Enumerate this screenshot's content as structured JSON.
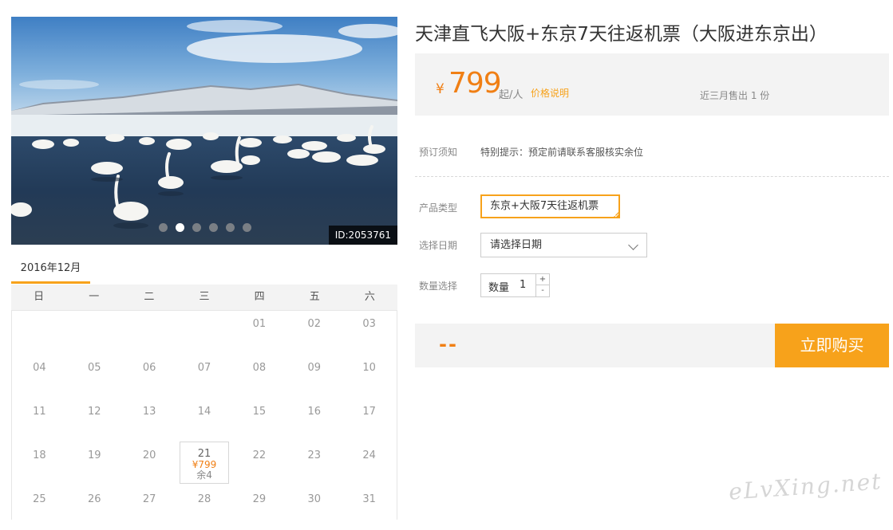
{
  "gallery": {
    "image_alt": "swans on a frozen lake with snowy mountains",
    "slide_count": 6,
    "active_slide": 2,
    "image_id": "ID:2053761"
  },
  "calendar": {
    "month": "2016年12月",
    "weekdays": [
      "日",
      "一",
      "二",
      "三",
      "四",
      "五",
      "六"
    ],
    "weeks": [
      [
        null,
        null,
        null,
        null,
        "01",
        "02",
        "03"
      ],
      [
        "04",
        "05",
        "06",
        "07",
        "08",
        "09",
        "10"
      ],
      [
        "11",
        "12",
        "13",
        "14",
        "15",
        "16",
        "17"
      ],
      [
        "18",
        "19",
        "20",
        "21",
        "22",
        "23",
        "24"
      ],
      [
        "25",
        "26",
        "27",
        "28",
        "29",
        "30",
        "31"
      ]
    ],
    "available": {
      "day": "21",
      "price": "¥799",
      "remaining": "余4"
    }
  },
  "product": {
    "title": "天津直飞大阪+东京7天往返机票（大阪进东京出）",
    "price": {
      "currency": "¥",
      "amount": "799",
      "unit": "起/人",
      "note": "价格说明",
      "sold": "近三月售出 1 份"
    },
    "notice": {
      "label": "预订须知",
      "text": "特别提示：预定前请联系客服核实余位"
    },
    "type": {
      "label": "产品类型",
      "option": "东京+大阪7天往返机票"
    },
    "date": {
      "label": "选择日期",
      "placeholder": "请选择日期"
    },
    "quantity": {
      "label": "数量选择",
      "inner_label": "数量",
      "value": "1",
      "plus": "+",
      "minus": "-"
    }
  },
  "order": {
    "total": "--",
    "buy_label": "立即购买"
  },
  "watermark": "eLvXing.net",
  "colors": {
    "accent": "#f7a21b",
    "price": "#f07f14",
    "panel": "#f3f3f3"
  }
}
